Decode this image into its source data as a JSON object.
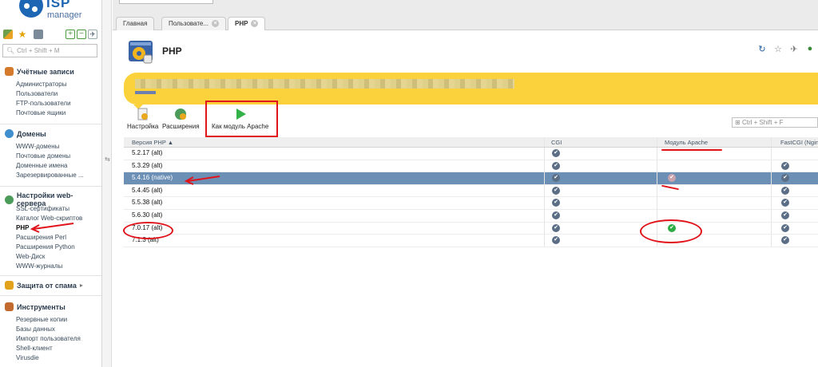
{
  "app": {
    "logo_top": "ISP",
    "logo_bottom": "manager",
    "top_input_value": "",
    "notice_text": ""
  },
  "sidebar": {
    "search_placeholder": "Ctrl + Shift + M",
    "groups": [
      {
        "title": "Учётные записи",
        "icon": "users-icon",
        "items": [
          "Администраторы",
          "Пользователи",
          "FTP-пользователи",
          "Почтовые ящики"
        ]
      },
      {
        "title": "Домены",
        "icon": "globe-icon",
        "items": [
          "WWW-домены",
          "Почтовые домены",
          "Доменные имена",
          "Зарезервированные ..."
        ]
      },
      {
        "title": "Настройки web-сервера",
        "icon": "globe-gear-icon",
        "items": [
          "SSL-сертификаты",
          "Каталог Web-скриптов",
          "PHP",
          "Расширения Perl",
          "Расширения Python",
          "Web-Диск",
          "WWW-журналы"
        ],
        "active_index": 2
      },
      {
        "title": "Защита от спама",
        "icon": "shield-icon",
        "items": []
      },
      {
        "title": "Инструменты",
        "icon": "tools-icon",
        "items": [
          "Резервные копии",
          "Базы данных",
          "Импорт пользователя",
          "Shell-клиент",
          "Virusdie"
        ]
      }
    ]
  },
  "tabs": [
    {
      "label": "Главная",
      "closable": false
    },
    {
      "label": "Пользовате...",
      "closable": true
    },
    {
      "label": "PHP",
      "closable": true,
      "active": true
    }
  ],
  "page": {
    "title": "PHP",
    "banner_link": "",
    "toolbar": {
      "settings_label": "Настройка",
      "extensions_label": "Расширения",
      "apache_module_label": "Как модуль Apache"
    },
    "table_search_placeholder": "Ctrl + Shift + F"
  },
  "table": {
    "columns": [
      "Версия PHP ▲",
      "CGI",
      "Модуль Apache",
      "FastCGI (Ngin"
    ],
    "rows": [
      {
        "version": "5.2.17 (alt)",
        "cgi": true,
        "apache": false,
        "fastcgi": false
      },
      {
        "version": "5.3.29 (alt)",
        "cgi": true,
        "apache": false,
        "fastcgi": true
      },
      {
        "version": "5.4.16 (native)",
        "cgi": true,
        "apache": true,
        "fastcgi": true,
        "selected": true
      },
      {
        "version": "5.4.45 (alt)",
        "cgi": true,
        "apache": false,
        "fastcgi": true
      },
      {
        "version": "5.5.38 (alt)",
        "cgi": true,
        "apache": false,
        "fastcgi": true
      },
      {
        "version": "5.6.30 (alt)",
        "cgi": true,
        "apache": false,
        "fastcgi": true
      },
      {
        "version": "7.0.17 (alt)",
        "cgi": true,
        "apache": true,
        "apache_highlight": true,
        "fastcgi": true
      },
      {
        "version": "7.1.3 (alt)",
        "cgi": true,
        "apache": false,
        "fastcgi": true
      }
    ]
  },
  "colors": {
    "accent": "#1d66b3",
    "banner": "#fbd23c",
    "selected_row": "#6b8fb5",
    "annotation": "#e1141c",
    "check": "#5b6e86",
    "check_active": "#2eac45"
  }
}
